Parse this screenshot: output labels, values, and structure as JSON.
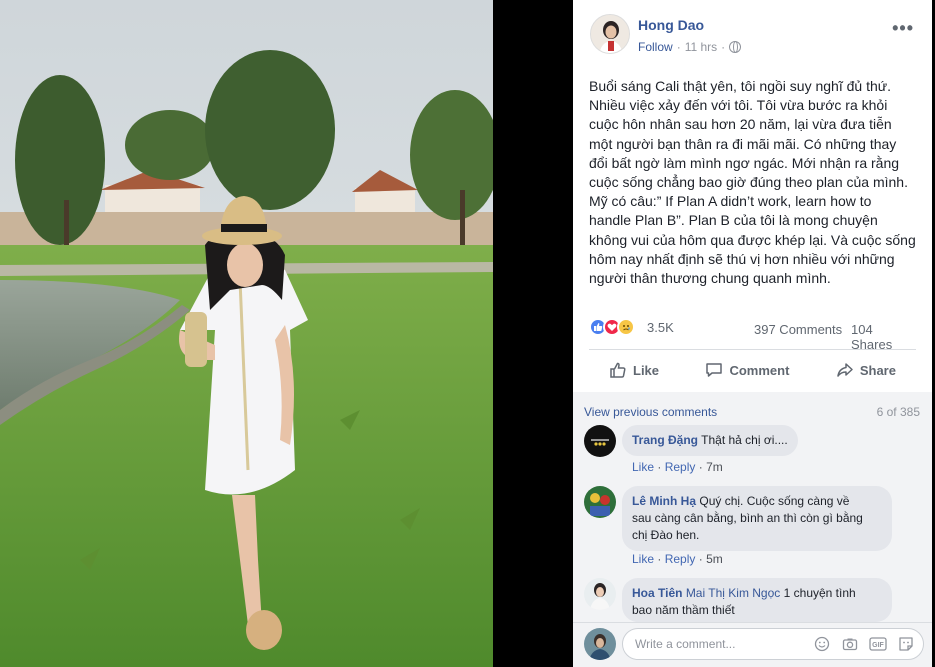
{
  "post": {
    "author": "Hong Dao",
    "follow_label": "Follow",
    "time": "11 hrs",
    "privacy_icon": "globe-icon",
    "more_label": "•••",
    "text": "Buổi sáng Cali thật yên, tôi ngồi suy nghĩ đủ thứ.\nNhiều việc xảy đến với tôi. Tôi vừa bước ra khỏi\ncuộc hôn nhân sau hơn 20 năm, lại vừa đưa tiễn\nmột người bạn thân ra đi mãi mãi. Có những thay\nđổi bất ngờ làm mình ngơ ngác. Mới nhận ra rằng\ncuộc sống chẳng bao giờ đúng theo plan của mình.\nMỹ có câu:” If Plan A didn’t work, learn how to\nhandle Plan B”. Plan B của tôi là mong chuyện\nkhông vui của hôm qua được khép lại. Và cuộc sống\nhôm nay nhất định sẽ thú vị hơn nhiều với những\nngười thân thương chung quanh mình."
  },
  "reactions": {
    "count": "3.5K",
    "comments": "397 Comments",
    "shares": "104 Shares",
    "icons": [
      "like-icon",
      "love-icon",
      "sad-icon"
    ]
  },
  "actions": {
    "like": "Like",
    "comment": "Comment",
    "share": "Share"
  },
  "comments_section": {
    "view_previous": "View previous comments",
    "page_count": "6 of 385",
    "items": [
      {
        "name": "Trang Đặng",
        "text": "Thật hả chị ơi....",
        "like": "Like",
        "reply": "Reply",
        "time": "7m"
      },
      {
        "name": "Lê Minh Hạ",
        "text": "Quý chị. Cuộc sống càng về",
        "text2": "sau càng cân bằng, bình an thì còn gì bằng",
        "text3": "chị Đào hen.",
        "like": "Like",
        "reply": "Reply",
        "time": "5m"
      },
      {
        "name": "Hoa Tiên",
        "tag": "Mai Thị Kim Ngọc",
        "text": "1 chuyện tình",
        "text2": "bao năm thầm thiết"
      }
    ]
  },
  "write_comment": {
    "placeholder": "Write a comment..."
  }
}
